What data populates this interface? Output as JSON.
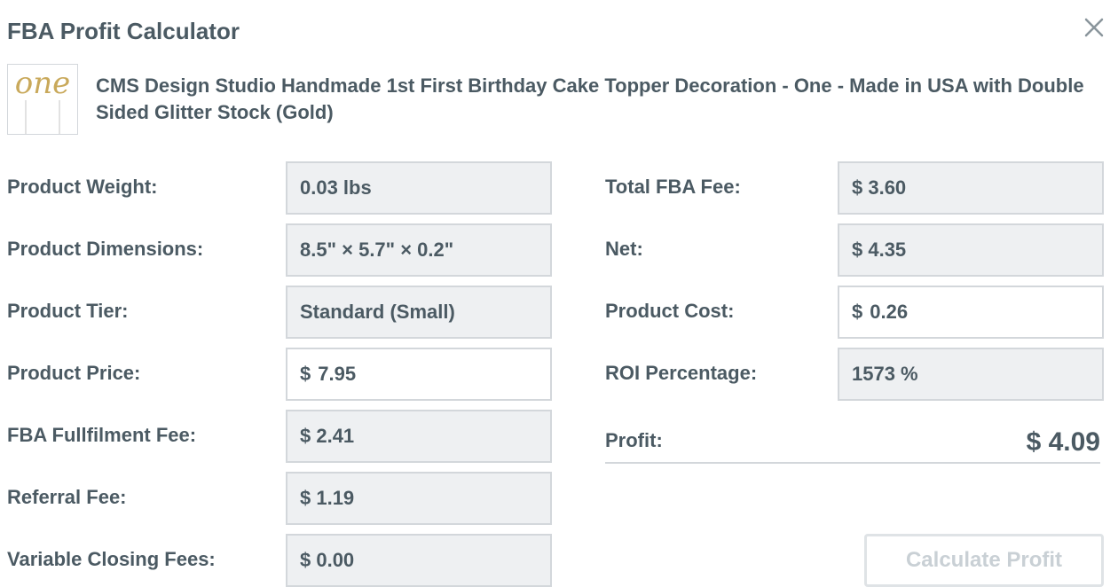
{
  "header": {
    "title": "FBA Profit Calculator"
  },
  "product": {
    "title": "CMS Design Studio Handmade 1st First Birthday Cake Topper Decoration - One - Made in USA with Double Sided Glitter Stock (Gold)",
    "thumbnail_text": "one"
  },
  "left_fields": {
    "weight": {
      "label": "Product Weight:",
      "value": "0.03 lbs"
    },
    "dimensions": {
      "label": "Product Dimensions:",
      "value": "8.5\" × 5.7\" × 0.2\""
    },
    "tier": {
      "label": "Product Tier:",
      "value": "Standard (Small)"
    },
    "price": {
      "label": "Product Price:",
      "currency": "$",
      "value": "7.95"
    },
    "fulfilment_fee": {
      "label": "FBA Fullfilment Fee:",
      "value": "$ 2.41"
    },
    "referral_fee": {
      "label": "Referral Fee:",
      "value": "$ 1.19"
    },
    "closing_fees": {
      "label": "Variable Closing Fees:",
      "value": "$ 0.00"
    }
  },
  "right_fields": {
    "total_fee": {
      "label": "Total FBA Fee:",
      "value": "$ 3.60"
    },
    "net": {
      "label": "Net:",
      "value": "$ 4.35"
    },
    "cost": {
      "label": "Product Cost:",
      "currency": "$",
      "value": "0.26"
    },
    "roi": {
      "label": "ROI Percentage:",
      "value": "1573 %"
    }
  },
  "profit": {
    "label": "Profit:",
    "value": "$ 4.09"
  },
  "actions": {
    "calculate_label": "Calculate Profit"
  },
  "colors": {
    "text": "#4b5a63",
    "field_bg": "#eef0f2",
    "border": "#d3d7db",
    "disabled_text": "#c9d0d5",
    "gold": "#c9a95b"
  }
}
